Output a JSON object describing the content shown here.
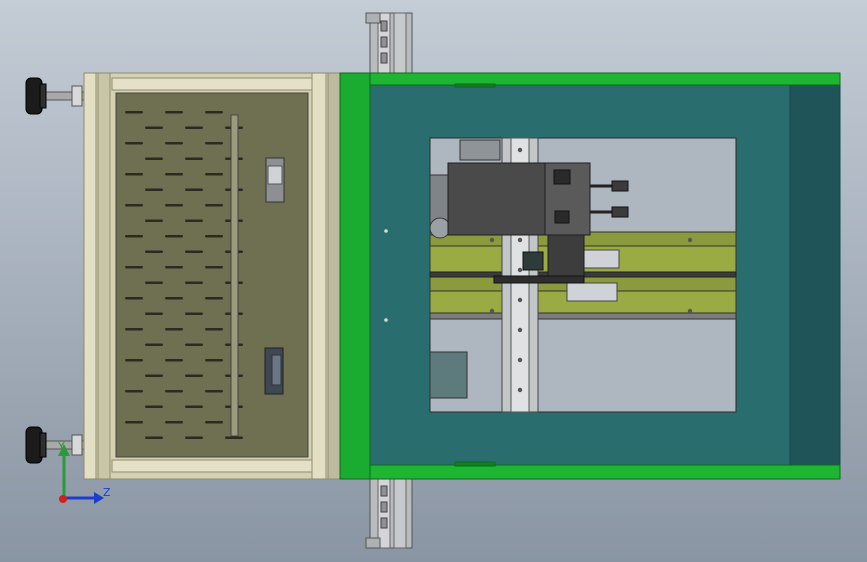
{
  "viewport": {
    "background_top": "#c4ccd6",
    "background_bottom": "#8a95a3"
  },
  "colors": {
    "frame_beige": "#d5d2b4",
    "frame_beige_dark": "#8f8c70",
    "tray_olive": "#6f6f52",
    "tray_slot": "#2b2b22",
    "green_frame": "#17a22d",
    "green_dark": "#0c6a1a",
    "teal_panel": "#2a6d6f",
    "teal_edge": "#1f5558",
    "window_grey": "#aeb6c0",
    "rail_olive": "#8a9a3c",
    "device_dark": "#4a4a4a",
    "foot_black": "#1b1b1b",
    "rod_grey": "#a9a9a9",
    "axis_y": "#2a9a3a",
    "axis_z": "#1a3fd0",
    "axis_x": "#d02020"
  },
  "triad": {
    "y_label": "Y",
    "z_label": "Z"
  }
}
